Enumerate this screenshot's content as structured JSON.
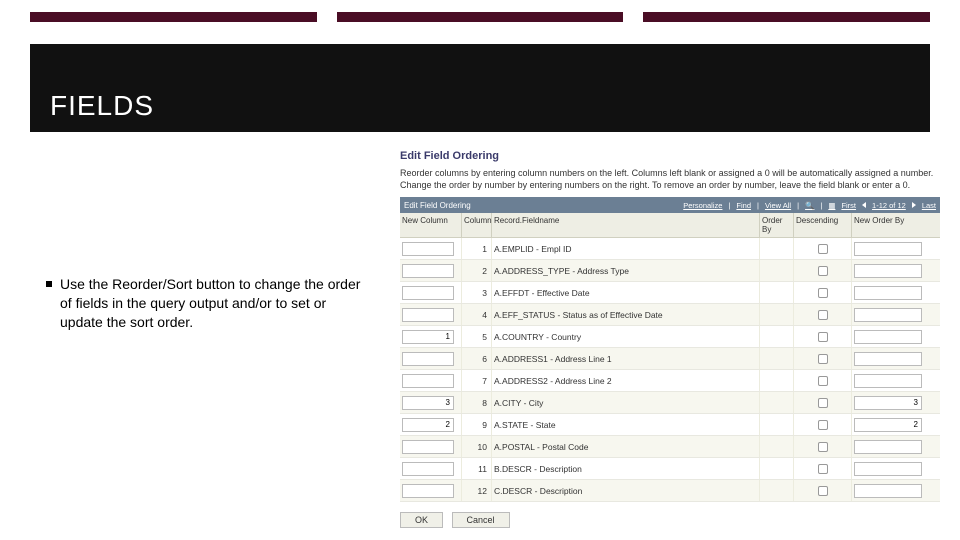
{
  "slide": {
    "title": "FIELDS",
    "bullet": "Use the Reorder/Sort button to change the order of fields in the query output and/or to set or update the sort order."
  },
  "dialog": {
    "heading": "Edit Field Ordering",
    "instructions": "Reorder columns by entering column numbers on the left. Columns left blank or assigned a 0 will be automatically assigned a number. Change the order by number by entering numbers on the right. To remove an order by number, leave the field blank or enter a 0.",
    "gridbar_left": "Edit Field Ordering",
    "gridbar_links": {
      "personalize": "Personalize",
      "find": "Find",
      "viewall": "View All"
    },
    "gridbar_page_label": "First",
    "gridbar_page_range": "1-12 of 12",
    "gridbar_page_last": "Last",
    "headers": {
      "newcol": "New Column",
      "column": "Column",
      "record": "Record.Fieldname",
      "orderby": "Order By",
      "descending": "Descending",
      "neworder": "New Order By"
    },
    "rows": [
      {
        "newcol": "",
        "col": "1",
        "rec": "A.EMPLID - Empl ID",
        "ord": "",
        "neword": ""
      },
      {
        "newcol": "",
        "col": "2",
        "rec": "A.ADDRESS_TYPE - Address Type",
        "ord": "",
        "neword": ""
      },
      {
        "newcol": "",
        "col": "3",
        "rec": "A.EFFDT - Effective Date",
        "ord": "",
        "neword": ""
      },
      {
        "newcol": "",
        "col": "4",
        "rec": "A.EFF_STATUS - Status as of Effective Date",
        "ord": "",
        "neword": ""
      },
      {
        "newcol": "1",
        "col": "5",
        "rec": "A.COUNTRY - Country",
        "ord": "",
        "neword": ""
      },
      {
        "newcol": "",
        "col": "6",
        "rec": "A.ADDRESS1 - Address Line 1",
        "ord": "",
        "neword": ""
      },
      {
        "newcol": "",
        "col": "7",
        "rec": "A.ADDRESS2 - Address Line 2",
        "ord": "",
        "neword": ""
      },
      {
        "newcol": "3",
        "col": "8",
        "rec": "A.CITY - City",
        "ord": "",
        "neword": "3"
      },
      {
        "newcol": "2",
        "col": "9",
        "rec": "A.STATE - State",
        "ord": "",
        "neword": "2"
      },
      {
        "newcol": "",
        "col": "10",
        "rec": "A.POSTAL - Postal Code",
        "ord": "",
        "neword": ""
      },
      {
        "newcol": "",
        "col": "11",
        "rec": "B.DESCR - Description",
        "ord": "",
        "neword": ""
      },
      {
        "newcol": "",
        "col": "12",
        "rec": "C.DESCR - Description",
        "ord": "",
        "neword": ""
      }
    ],
    "buttons": {
      "ok": "OK",
      "cancel": "Cancel"
    }
  }
}
